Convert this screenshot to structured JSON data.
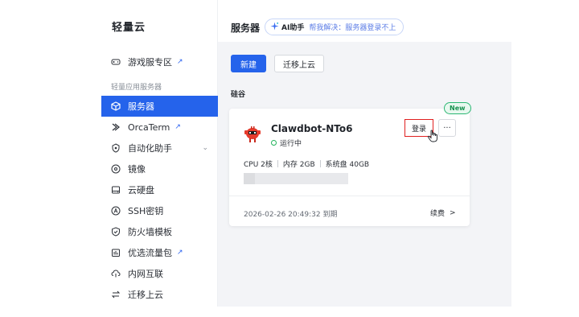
{
  "sidebar": {
    "brand": "轻量云",
    "group_label": "轻量应用服务器",
    "items": [
      {
        "label": "游戏服专区",
        "icon": "gamepad-icon",
        "external": true
      },
      {
        "label": "服务器",
        "icon": "cube-icon",
        "active": true
      },
      {
        "label": "OrcaTerm",
        "icon": "terminal-icon",
        "external": true
      },
      {
        "label": "自动化助手",
        "icon": "automation-icon",
        "expandable": true
      },
      {
        "label": "镜像",
        "icon": "disc-icon"
      },
      {
        "label": "云硬盘",
        "icon": "disk-icon"
      },
      {
        "label": "SSH密钥",
        "icon": "key-icon"
      },
      {
        "label": "防火墙模板",
        "icon": "shield-icon"
      },
      {
        "label": "优选流量包",
        "icon": "package-icon",
        "external": true
      },
      {
        "label": "内网互联",
        "icon": "network-icon"
      },
      {
        "label": "迁移上云",
        "icon": "migrate-icon"
      }
    ]
  },
  "header": {
    "title": "服务器",
    "ai_label": "AI助手",
    "ai_hint": "帮我解决：服务器登录不上"
  },
  "toolbar": {
    "new_label": "新建",
    "migrate_label": "迁移上云"
  },
  "region": "硅谷",
  "instance": {
    "badge": "New",
    "name": "Clawdbot-NTo6",
    "status": "运行中",
    "login_label": "登录",
    "more_label": "···",
    "cpu": "CPU 2核",
    "memory": "内存 2GB",
    "disk": "系统盘 40GB",
    "expire": "2026-02-26 20:49:32 到期",
    "renew_label": "续费",
    "renew_arrow": ">"
  },
  "colors": {
    "accent": "#2563eb",
    "status_green": "#22b35b",
    "highlight_red": "#e02020"
  }
}
